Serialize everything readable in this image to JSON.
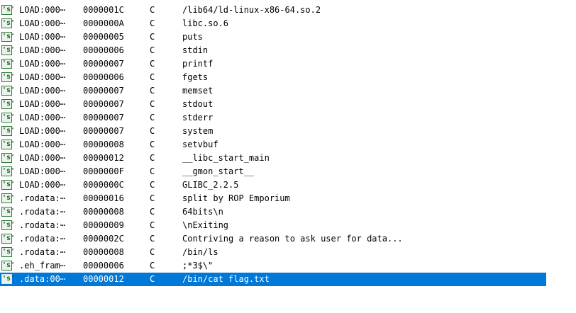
{
  "strings_table": {
    "icon": "string-icon",
    "icon_glyph": "'s'",
    "rows": [
      {
        "address": "LOAD:000⋯",
        "length": "0000001C",
        "type": "C",
        "string": "/lib64/ld-linux-x86-64.so.2"
      },
      {
        "address": "LOAD:000⋯",
        "length": "0000000A",
        "type": "C",
        "string": "libc.so.6"
      },
      {
        "address": "LOAD:000⋯",
        "length": "00000005",
        "type": "C",
        "string": "puts"
      },
      {
        "address": "LOAD:000⋯",
        "length": "00000006",
        "type": "C",
        "string": "stdin"
      },
      {
        "address": "LOAD:000⋯",
        "length": "00000007",
        "type": "C",
        "string": "printf"
      },
      {
        "address": "LOAD:000⋯",
        "length": "00000006",
        "type": "C",
        "string": "fgets"
      },
      {
        "address": "LOAD:000⋯",
        "length": "00000007",
        "type": "C",
        "string": "memset"
      },
      {
        "address": "LOAD:000⋯",
        "length": "00000007",
        "type": "C",
        "string": "stdout"
      },
      {
        "address": "LOAD:000⋯",
        "length": "00000007",
        "type": "C",
        "string": "stderr"
      },
      {
        "address": "LOAD:000⋯",
        "length": "00000007",
        "type": "C",
        "string": "system"
      },
      {
        "address": "LOAD:000⋯",
        "length": "00000008",
        "type": "C",
        "string": "setvbuf"
      },
      {
        "address": "LOAD:000⋯",
        "length": "00000012",
        "type": "C",
        "string": "__libc_start_main"
      },
      {
        "address": "LOAD:000⋯",
        "length": "0000000F",
        "type": "C",
        "string": "__gmon_start__"
      },
      {
        "address": "LOAD:000⋯",
        "length": "0000000C",
        "type": "C",
        "string": "GLIBC_2.2.5"
      },
      {
        "address": ".rodata:⋯",
        "length": "00000016",
        "type": "C",
        "string": "split by ROP Emporium"
      },
      {
        "address": ".rodata:⋯",
        "length": "00000008",
        "type": "C",
        "string": "64bits\\n"
      },
      {
        "address": ".rodata:⋯",
        "length": "00000009",
        "type": "C",
        "string": "\\nExiting"
      },
      {
        "address": ".rodata:⋯",
        "length": "0000002C",
        "type": "C",
        "string": "Contriving a reason to ask user for data..."
      },
      {
        "address": ".rodata:⋯",
        "length": "00000008",
        "type": "C",
        "string": "/bin/ls"
      },
      {
        "address": ".eh_fram⋯",
        "length": "00000006",
        "type": "C",
        "string": ";*3$\\\""
      },
      {
        "address": ".data:00⋯",
        "length": "00000012",
        "type": "C",
        "string": "/bin/cat flag.txt",
        "selected": true
      }
    ]
  },
  "colors": {
    "selection": "#0078d7",
    "icon_border": "#2f7a3a"
  }
}
